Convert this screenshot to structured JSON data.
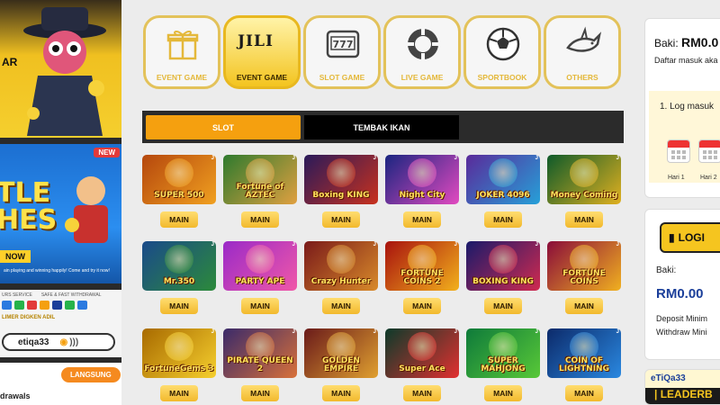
{
  "left": {
    "promo1": {
      "partial_text": "AR"
    },
    "promo2": {
      "badge": "NEW",
      "title_line1": "TLE",
      "title_line2": "HES",
      "now": "NOW",
      "fine_print": "ain playing and winning happily! Come and try it now!"
    },
    "promo3": {
      "services": [
        "URS SERVICE",
        "SAFE & FAST WITHDRAWAL"
      ],
      "download_text": "LIMER DIGKEN ADIL",
      "tag": "etiqa33"
    },
    "promo4": {
      "button": "LANGSUNG",
      "withdrawals": "drawals"
    }
  },
  "categories": [
    {
      "label": "EVENT GAME",
      "icon": "gift-icon",
      "active": false
    },
    {
      "label": "EVENT GAME",
      "icon": "jili-logo-icon",
      "active": true,
      "logo_text": "JILI"
    },
    {
      "label": "SLOT GAME",
      "icon": "slot-machine-777-icon",
      "active": false,
      "glyph": "777"
    },
    {
      "label": "LIVE GAME",
      "icon": "casino-chip-icon",
      "active": false
    },
    {
      "label": "SPORTBOOK",
      "icon": "soccer-ball-icon",
      "active": false
    },
    {
      "label": "OTHERS",
      "icon": "shark-icon",
      "active": false
    }
  ],
  "tabs": [
    {
      "label": "SLOT",
      "active": true
    },
    {
      "label": "TEMBAK IKAN",
      "active": false
    }
  ],
  "games": [
    {
      "name": "SUPER 500",
      "button": "MAIN",
      "colors": [
        "#b5470d",
        "#f0a020"
      ]
    },
    {
      "name": "Fortune of AZTEC",
      "button": "MAIN",
      "colors": [
        "#2e7a2e",
        "#e0a040"
      ]
    },
    {
      "name": "Boxing KING",
      "button": "MAIN",
      "colors": [
        "#2a1a5a",
        "#c8311e"
      ]
    },
    {
      "name": "Night City",
      "button": "MAIN",
      "colors": [
        "#1a2580",
        "#e24ac0"
      ]
    },
    {
      "name": "JOKER 4096",
      "button": "MAIN",
      "colors": [
        "#5a2a9a",
        "#26a0d8"
      ]
    },
    {
      "name": "Money Coming",
      "button": "MAIN",
      "colors": [
        "#0e5a2a",
        "#e0b020"
      ]
    },
    {
      "name": "Mr.350",
      "button": "MAIN",
      "colors": [
        "#1a4a8a",
        "#2c8a3a"
      ]
    },
    {
      "name": "PARTY APE",
      "button": "MAIN",
      "colors": [
        "#9a2ac8",
        "#f058a8"
      ]
    },
    {
      "name": "Crazy Hunter",
      "button": "MAIN",
      "colors": [
        "#7a1a1a",
        "#d88a2a"
      ]
    },
    {
      "name": "FORTUNE COINS 2",
      "button": "MAIN",
      "colors": [
        "#a8120e",
        "#f2b01c"
      ]
    },
    {
      "name": "BOXING KING",
      "button": "MAIN",
      "colors": [
        "#1a1a6a",
        "#d02a50"
      ]
    },
    {
      "name": "FORTUNE COINS",
      "button": "MAIN",
      "colors": [
        "#8a0c3a",
        "#f0b020"
      ]
    },
    {
      "name": "FortuneGems 3",
      "button": "MAIN",
      "colors": [
        "#a86a00",
        "#f5cf2e"
      ]
    },
    {
      "name": "PIRATE QUEEN 2",
      "button": "MAIN",
      "colors": [
        "#3a2a6a",
        "#d8703a"
      ]
    },
    {
      "name": "GOLDEN EMPIRE",
      "button": "MAIN",
      "colors": [
        "#6a1a1a",
        "#e0a030"
      ]
    },
    {
      "name": "Super Ace",
      "button": "MAIN",
      "colors": [
        "#0c3a2a",
        "#e23030"
      ]
    },
    {
      "name": "SUPER MAHJONG",
      "button": "MAIN",
      "colors": [
        "#0e7a3a",
        "#58c838"
      ]
    },
    {
      "name": "COIN OF LIGHTNING",
      "button": "MAIN",
      "colors": [
        "#0c2a6a",
        "#2a88e0"
      ]
    }
  ],
  "right": {
    "panel1": {
      "baki_label": "Baki:",
      "baki_value": "RM0.0",
      "daftar_text": "Daftar masuk aka aktif",
      "log_item": "1. Log masuk",
      "days": [
        "Hari 1",
        "Hari 2"
      ]
    },
    "panel2": {
      "login_label": "LOGI",
      "baki_label": "Baki:",
      "baki_value": "RM0.00",
      "deposit_text": "Deposit Minim",
      "withdraw_text": "Withdraw Mini"
    },
    "panel3": {
      "brand": "eTiQa33",
      "leaderboard": "| LEADERB"
    }
  }
}
